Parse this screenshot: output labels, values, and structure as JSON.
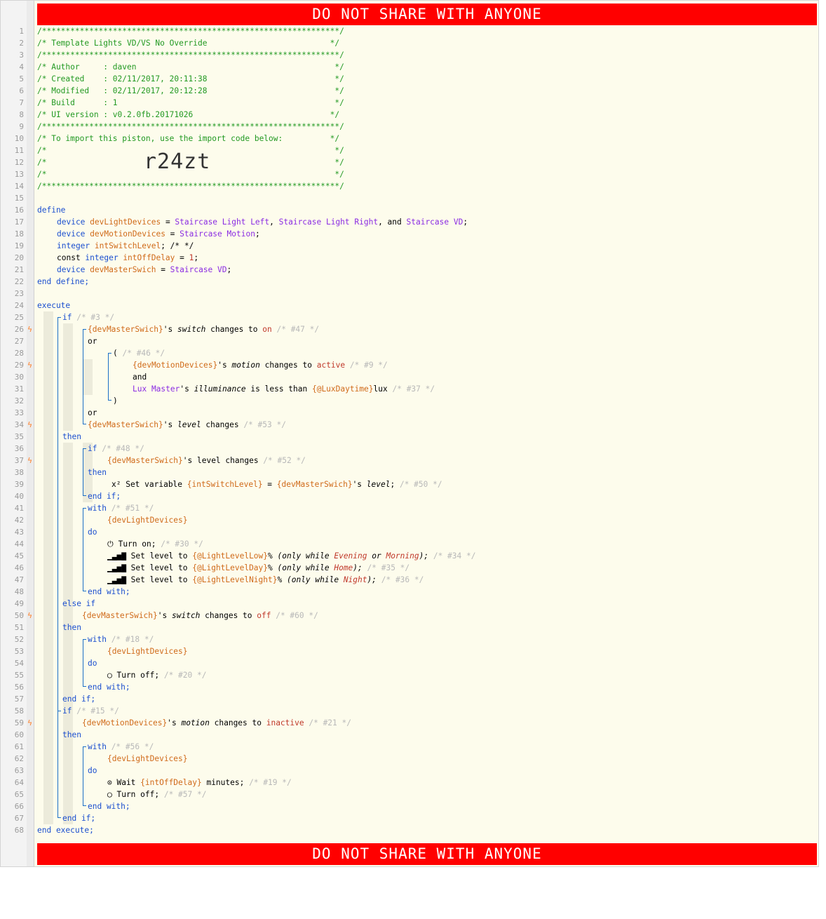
{
  "banner": "DO NOT SHARE WITH ANYONE",
  "import_code": "r24zt",
  "lines": [
    {
      "n": "1",
      "bolt": false,
      "indent": 0,
      "parts": [
        [
          "c-com",
          "/***************************************************************/"
        ]
      ]
    },
    {
      "n": "2",
      "bolt": false,
      "indent": 0,
      "parts": [
        [
          "c-com",
          "/* Template Lights VD/VS No Override                          */"
        ]
      ]
    },
    {
      "n": "3",
      "bolt": false,
      "indent": 0,
      "parts": [
        [
          "c-com",
          "/***************************************************************/"
        ]
      ]
    },
    {
      "n": "4",
      "bolt": false,
      "indent": 0,
      "parts": [
        [
          "c-com",
          "/* Author     : daven                                          */"
        ]
      ]
    },
    {
      "n": "5",
      "bolt": false,
      "indent": 0,
      "parts": [
        [
          "c-com",
          "/* Created    : 02/11/2017, 20:11:38                           */"
        ]
      ]
    },
    {
      "n": "6",
      "bolt": false,
      "indent": 0,
      "parts": [
        [
          "c-com",
          "/* Modified   : 02/11/2017, 20:12:28                           */"
        ]
      ]
    },
    {
      "n": "7",
      "bolt": false,
      "indent": 0,
      "parts": [
        [
          "c-com",
          "/* Build      : 1                                              */"
        ]
      ]
    },
    {
      "n": "8",
      "bolt": false,
      "indent": 0,
      "parts": [
        [
          "c-com",
          "/* UI version : v0.2.0fb.20171026                             */"
        ]
      ]
    },
    {
      "n": "9",
      "bolt": false,
      "indent": 0,
      "parts": [
        [
          "c-com",
          "/***************************************************************/"
        ]
      ]
    },
    {
      "n": "10",
      "bolt": false,
      "indent": 0,
      "parts": [
        [
          "c-com",
          "/* To import this piston, use the import code below:          */"
        ]
      ]
    },
    {
      "n": "11",
      "bolt": false,
      "indent": 0,
      "parts": [
        [
          "c-com",
          "/*                                                             */"
        ]
      ]
    },
    {
      "n": "12",
      "bolt": false,
      "indent": 0,
      "parts": [
        [
          "c-com",
          "/*                                                             */"
        ]
      ]
    },
    {
      "n": "13",
      "bolt": false,
      "indent": 0,
      "parts": [
        [
          "c-com",
          "/*                                                             */"
        ]
      ]
    },
    {
      "n": "14",
      "bolt": false,
      "indent": 0,
      "parts": [
        [
          "c-com",
          "/***************************************************************/"
        ]
      ]
    },
    {
      "n": "15",
      "bolt": false,
      "indent": 0,
      "parts": []
    },
    {
      "n": "16",
      "bolt": false,
      "indent": 0,
      "parts": [
        [
          "c-kw",
          "define"
        ]
      ]
    },
    {
      "n": "17",
      "bolt": false,
      "indent": 28,
      "parts": [
        [
          "c-kw",
          "device "
        ],
        [
          "c-var",
          "devLightDevices"
        ],
        [
          "c-op",
          " = "
        ],
        [
          "c-dev",
          "Staircase Light Left"
        ],
        [
          "c-op",
          ", "
        ],
        [
          "c-dev",
          "Staircase Light Right"
        ],
        [
          "c-op",
          ", and "
        ],
        [
          "c-dev",
          "Staircase VD"
        ],
        [
          "c-op",
          ";"
        ]
      ]
    },
    {
      "n": "18",
      "bolt": false,
      "indent": 28,
      "parts": [
        [
          "c-kw",
          "device "
        ],
        [
          "c-var",
          "devMotionDevices"
        ],
        [
          "c-op",
          " = "
        ],
        [
          "c-dev",
          "Staircase Motion"
        ],
        [
          "c-op",
          ";"
        ]
      ]
    },
    {
      "n": "19",
      "bolt": false,
      "indent": 28,
      "parts": [
        [
          "c-kw",
          "integer "
        ],
        [
          "c-var",
          "intSwitchLevel"
        ],
        [
          "c-op",
          "; /* */"
        ]
      ]
    },
    {
      "n": "20",
      "bolt": false,
      "indent": 28,
      "parts": [
        [
          "c-op",
          "const "
        ],
        [
          "c-kw",
          "integer "
        ],
        [
          "c-var",
          "intOffDelay"
        ],
        [
          "c-op",
          " = "
        ],
        [
          "c-val",
          "1"
        ],
        [
          "c-op",
          ";"
        ]
      ]
    },
    {
      "n": "21",
      "bolt": false,
      "indent": 28,
      "parts": [
        [
          "c-kw",
          "device "
        ],
        [
          "c-var",
          "devMasterSwich"
        ],
        [
          "c-op",
          " = "
        ],
        [
          "c-dev",
          "Staircase VD"
        ],
        [
          "c-op",
          ";"
        ]
      ]
    },
    {
      "n": "22",
      "bolt": false,
      "indent": 0,
      "parts": [
        [
          "c-kw",
          "end define;"
        ]
      ]
    },
    {
      "n": "23",
      "bolt": false,
      "indent": 0,
      "parts": []
    },
    {
      "n": "24",
      "bolt": false,
      "indent": 0,
      "parts": [
        [
          "c-kw",
          "execute"
        ]
      ]
    },
    {
      "n": "25",
      "bolt": false,
      "indent": 36,
      "parts": [
        [
          "c-kw",
          "if "
        ],
        [
          "c-dim",
          "/* #3 */"
        ]
      ]
    },
    {
      "n": "26",
      "bolt": true,
      "indent": 72,
      "parts": [
        [
          "c-var",
          "{devMasterSwich}"
        ],
        [
          "c-op",
          "'s "
        ],
        [
          "c-op it",
          "switch"
        ],
        [
          "c-op",
          " changes to "
        ],
        [
          "c-val",
          "on"
        ],
        [
          "c-op",
          " "
        ],
        [
          "c-dim",
          "/* #47 */"
        ]
      ]
    },
    {
      "n": "27",
      "bolt": false,
      "indent": 72,
      "parts": [
        [
          "c-op",
          "or"
        ]
      ]
    },
    {
      "n": "28",
      "bolt": false,
      "indent": 108,
      "parts": [
        [
          "c-op",
          "( "
        ],
        [
          "c-dim",
          "/* #46 */"
        ]
      ]
    },
    {
      "n": "29",
      "bolt": true,
      "indent": 136,
      "parts": [
        [
          "c-var",
          "{devMotionDevices}"
        ],
        [
          "c-op",
          "'s "
        ],
        [
          "c-op it",
          "motion"
        ],
        [
          "c-op",
          " changes to "
        ],
        [
          "c-val",
          "active"
        ],
        [
          "c-op",
          " "
        ],
        [
          "c-dim",
          "/* #9 */"
        ]
      ]
    },
    {
      "n": "30",
      "bolt": false,
      "indent": 136,
      "parts": [
        [
          "c-op",
          "and"
        ]
      ]
    },
    {
      "n": "31",
      "bolt": false,
      "indent": 136,
      "parts": [
        [
          "c-dev",
          "Lux Master"
        ],
        [
          "c-op",
          "'s "
        ],
        [
          "c-op it",
          "illuminance"
        ],
        [
          "c-op",
          " is less than "
        ],
        [
          "c-var",
          "{@LuxDaytime}"
        ],
        [
          "c-op",
          "lux "
        ],
        [
          "c-dim",
          "/* #37 */"
        ]
      ]
    },
    {
      "n": "32",
      "bolt": false,
      "indent": 108,
      "parts": [
        [
          "c-op",
          ")"
        ]
      ]
    },
    {
      "n": "33",
      "bolt": false,
      "indent": 72,
      "parts": [
        [
          "c-op",
          "or"
        ]
      ]
    },
    {
      "n": "34",
      "bolt": true,
      "indent": 72,
      "parts": [
        [
          "c-var",
          "{devMasterSwich}"
        ],
        [
          "c-op",
          "'s "
        ],
        [
          "c-op it",
          "level"
        ],
        [
          "c-op",
          " changes "
        ],
        [
          "c-dim",
          "/* #53 */"
        ]
      ]
    },
    {
      "n": "35",
      "bolt": false,
      "indent": 36,
      "parts": [
        [
          "c-kw",
          "then"
        ]
      ]
    },
    {
      "n": "36",
      "bolt": false,
      "indent": 72,
      "parts": [
        [
          "c-kw",
          "if "
        ],
        [
          "c-dim",
          "/* #48 */"
        ]
      ]
    },
    {
      "n": "37",
      "bolt": true,
      "indent": 100,
      "parts": [
        [
          "c-var",
          "{devMasterSwich}"
        ],
        [
          "c-op",
          "'s level changes "
        ],
        [
          "c-dim",
          "/* #52 */"
        ]
      ]
    },
    {
      "n": "38",
      "bolt": false,
      "indent": 72,
      "parts": [
        [
          "c-kw",
          "then"
        ]
      ]
    },
    {
      "n": "39",
      "bolt": false,
      "indent": 106,
      "parts": [
        [
          "c-op",
          "x² Set variable "
        ],
        [
          "c-var",
          "{intSwitchLevel}"
        ],
        [
          "c-op",
          " = "
        ],
        [
          "c-var",
          "{devMasterSwich}"
        ],
        [
          "c-op",
          "'s "
        ],
        [
          "c-op it",
          "level"
        ],
        [
          "c-op",
          "; "
        ],
        [
          "c-dim",
          "/* #50 */"
        ]
      ]
    },
    {
      "n": "40",
      "bolt": false,
      "indent": 72,
      "parts": [
        [
          "c-kw",
          "end if;"
        ]
      ]
    },
    {
      "n": "41",
      "bolt": false,
      "indent": 72,
      "parts": [
        [
          "c-kw",
          "with "
        ],
        [
          "c-dim",
          "/* #51 */"
        ]
      ]
    },
    {
      "n": "42",
      "bolt": false,
      "indent": 100,
      "parts": [
        [
          "c-var",
          "{devLightDevices}"
        ]
      ]
    },
    {
      "n": "43",
      "bolt": false,
      "indent": 72,
      "parts": [
        [
          "c-kw",
          "do"
        ]
      ]
    },
    {
      "n": "44",
      "bolt": false,
      "indent": 100,
      "parts": [
        [
          "c-op",
          "⏻ Turn on; "
        ],
        [
          "c-dim",
          "/* #30 */"
        ]
      ]
    },
    {
      "n": "45",
      "bolt": false,
      "indent": 100,
      "parts": [
        [
          "c-op",
          "▁▃▅▇ Set level to "
        ],
        [
          "c-var",
          "{@LightLevelLow}"
        ],
        [
          "c-op",
          "% "
        ],
        [
          "c-op it",
          "(only while "
        ],
        [
          "c-val it",
          "Evening"
        ],
        [
          "c-op it",
          " or "
        ],
        [
          "c-val it",
          "Morning"
        ],
        [
          "c-op it",
          ");"
        ],
        [
          "c-op",
          " "
        ],
        [
          "c-dim",
          "/* #34 */"
        ]
      ]
    },
    {
      "n": "46",
      "bolt": false,
      "indent": 100,
      "parts": [
        [
          "c-op",
          "▁▃▅▇ Set level to "
        ],
        [
          "c-var",
          "{@LightLevelDay}"
        ],
        [
          "c-op",
          "% "
        ],
        [
          "c-op it",
          "(only while "
        ],
        [
          "c-val it",
          "Home"
        ],
        [
          "c-op it",
          ");"
        ],
        [
          "c-op",
          " "
        ],
        [
          "c-dim",
          "/* #35 */"
        ]
      ]
    },
    {
      "n": "47",
      "bolt": false,
      "indent": 100,
      "parts": [
        [
          "c-op",
          "▁▃▅▇ Set level to "
        ],
        [
          "c-var",
          "{@LightLevelNight}"
        ],
        [
          "c-op",
          "% "
        ],
        [
          "c-op it",
          "(only while "
        ],
        [
          "c-val it",
          "Night"
        ],
        [
          "c-op it",
          ");"
        ],
        [
          "c-op",
          " "
        ],
        [
          "c-dim",
          "/* #36 */"
        ]
      ]
    },
    {
      "n": "48",
      "bolt": false,
      "indent": 72,
      "parts": [
        [
          "c-kw",
          "end with;"
        ]
      ]
    },
    {
      "n": "49",
      "bolt": false,
      "indent": 36,
      "parts": [
        [
          "c-kw",
          "else if"
        ]
      ]
    },
    {
      "n": "50",
      "bolt": true,
      "indent": 64,
      "parts": [
        [
          "c-var",
          "{devMasterSwich}"
        ],
        [
          "c-op",
          "'s "
        ],
        [
          "c-op it",
          "switch"
        ],
        [
          "c-op",
          " changes to "
        ],
        [
          "c-val",
          "off"
        ],
        [
          "c-op",
          " "
        ],
        [
          "c-dim",
          "/* #60 */"
        ]
      ]
    },
    {
      "n": "51",
      "bolt": false,
      "indent": 36,
      "parts": [
        [
          "c-kw",
          "then"
        ]
      ]
    },
    {
      "n": "52",
      "bolt": false,
      "indent": 72,
      "parts": [
        [
          "c-kw",
          "with "
        ],
        [
          "c-dim",
          "/* #18 */"
        ]
      ]
    },
    {
      "n": "53",
      "bolt": false,
      "indent": 100,
      "parts": [
        [
          "c-var",
          "{devLightDevices}"
        ]
      ]
    },
    {
      "n": "54",
      "bolt": false,
      "indent": 72,
      "parts": [
        [
          "c-kw",
          "do"
        ]
      ]
    },
    {
      "n": "55",
      "bolt": false,
      "indent": 100,
      "parts": [
        [
          "c-op",
          "◯ Turn off; "
        ],
        [
          "c-dim",
          "/* #20 */"
        ]
      ]
    },
    {
      "n": "56",
      "bolt": false,
      "indent": 72,
      "parts": [
        [
          "c-kw",
          "end with;"
        ]
      ]
    },
    {
      "n": "57",
      "bolt": false,
      "indent": 36,
      "parts": [
        [
          "c-kw",
          "end if;"
        ]
      ]
    },
    {
      "n": "58",
      "bolt": false,
      "indent": 36,
      "parts": [
        [
          "c-kw",
          "if "
        ],
        [
          "c-dim",
          "/* #15 */"
        ]
      ]
    },
    {
      "n": "59",
      "bolt": true,
      "indent": 64,
      "parts": [
        [
          "c-var",
          "{devMotionDevices}"
        ],
        [
          "c-op",
          "'s "
        ],
        [
          "c-op it",
          "motion"
        ],
        [
          "c-op",
          " changes to "
        ],
        [
          "c-val",
          "inactive"
        ],
        [
          "c-op",
          " "
        ],
        [
          "c-dim",
          "/* #21 */"
        ]
      ]
    },
    {
      "n": "60",
      "bolt": false,
      "indent": 36,
      "parts": [
        [
          "c-kw",
          "then"
        ]
      ]
    },
    {
      "n": "61",
      "bolt": false,
      "indent": 72,
      "parts": [
        [
          "c-kw",
          "with "
        ],
        [
          "c-dim",
          "/* #56 */"
        ]
      ]
    },
    {
      "n": "62",
      "bolt": false,
      "indent": 100,
      "parts": [
        [
          "c-var",
          "{devLightDevices}"
        ]
      ]
    },
    {
      "n": "63",
      "bolt": false,
      "indent": 72,
      "parts": [
        [
          "c-kw",
          "do"
        ]
      ]
    },
    {
      "n": "64",
      "bolt": false,
      "indent": 100,
      "parts": [
        [
          "c-op",
          "⊙ Wait "
        ],
        [
          "c-var",
          "{intOffDelay}"
        ],
        [
          "c-op",
          " minutes; "
        ],
        [
          "c-dim",
          "/* #19 */"
        ]
      ]
    },
    {
      "n": "65",
      "bolt": false,
      "indent": 100,
      "parts": [
        [
          "c-op",
          "◯ Turn off; "
        ],
        [
          "c-dim",
          "/* #57 */"
        ]
      ]
    },
    {
      "n": "66",
      "bolt": false,
      "indent": 72,
      "parts": [
        [
          "c-kw",
          "end with;"
        ]
      ]
    },
    {
      "n": "67",
      "bolt": false,
      "indent": 36,
      "parts": [
        [
          "c-kw",
          "end if;"
        ]
      ]
    },
    {
      "n": "68",
      "bolt": false,
      "indent": 0,
      "parts": [
        [
          "c-kw",
          "end execute;"
        ]
      ]
    }
  ]
}
